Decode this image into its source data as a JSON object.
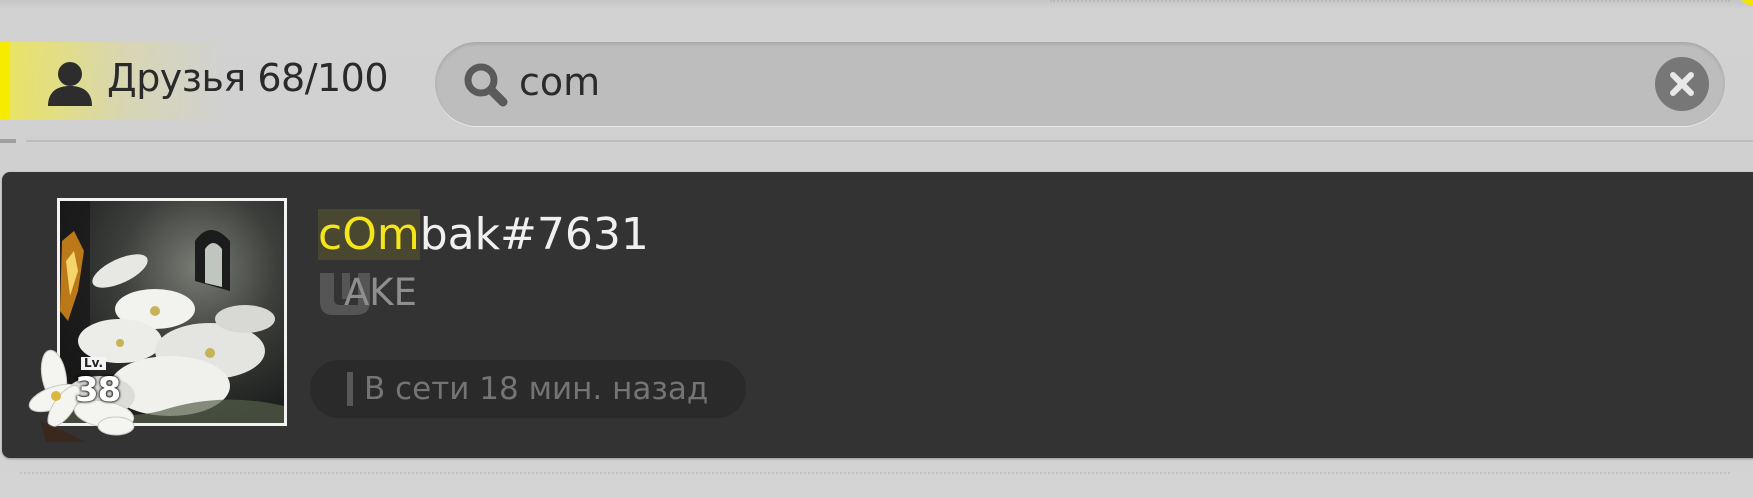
{
  "header": {
    "friends_label": "Друзья 68/100",
    "icon": "user-icon"
  },
  "search": {
    "value": "com",
    "icon": "search-icon",
    "clear_icon": "close-icon"
  },
  "friend": {
    "name_match": "cOm",
    "name_rest": "bak#7631",
    "club": "AKE",
    "level_label": "Lv.",
    "level": "38",
    "status": "В сети 18 мин. назад"
  },
  "colors": {
    "accent_yellow": "#f7eb00",
    "card_background": "#333333",
    "highlight_text": "#f4e61a"
  }
}
